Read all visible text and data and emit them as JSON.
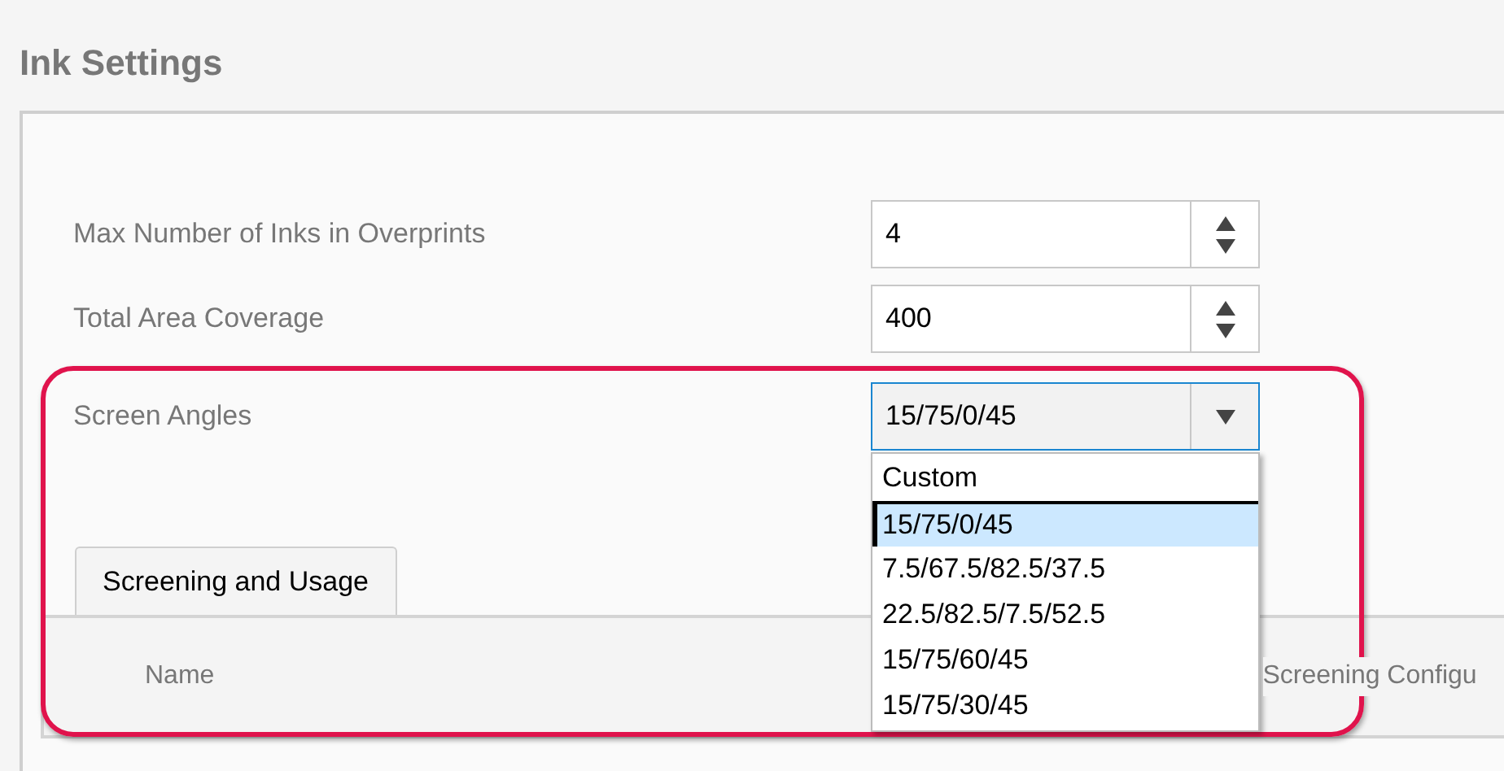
{
  "title": "Ink Settings",
  "fields": [
    {
      "label": "Max Number of Inks in Overprints",
      "value": "4",
      "kind": "spinner"
    },
    {
      "label": "Total Area Coverage",
      "value": "400",
      "kind": "spinner"
    },
    {
      "label": "Screen Angles",
      "value": "15/75/0/45",
      "kind": "combobox",
      "expanded": true,
      "options": [
        {
          "label": "Custom",
          "selected": false
        },
        {
          "label": "15/75/0/45",
          "selected": true
        },
        {
          "label": "7.5/67.5/82.5/37.5",
          "selected": false
        },
        {
          "label": "22.5/82.5/7.5/52.5",
          "selected": false
        },
        {
          "label": "15/75/60/45",
          "selected": false
        },
        {
          "label": "15/75/30/45",
          "selected": false
        }
      ]
    }
  ],
  "tabs": [
    {
      "label": "Screening and Usage",
      "selected": true
    }
  ],
  "table": {
    "columns": [
      "Name",
      "Screening Configu"
    ]
  }
}
